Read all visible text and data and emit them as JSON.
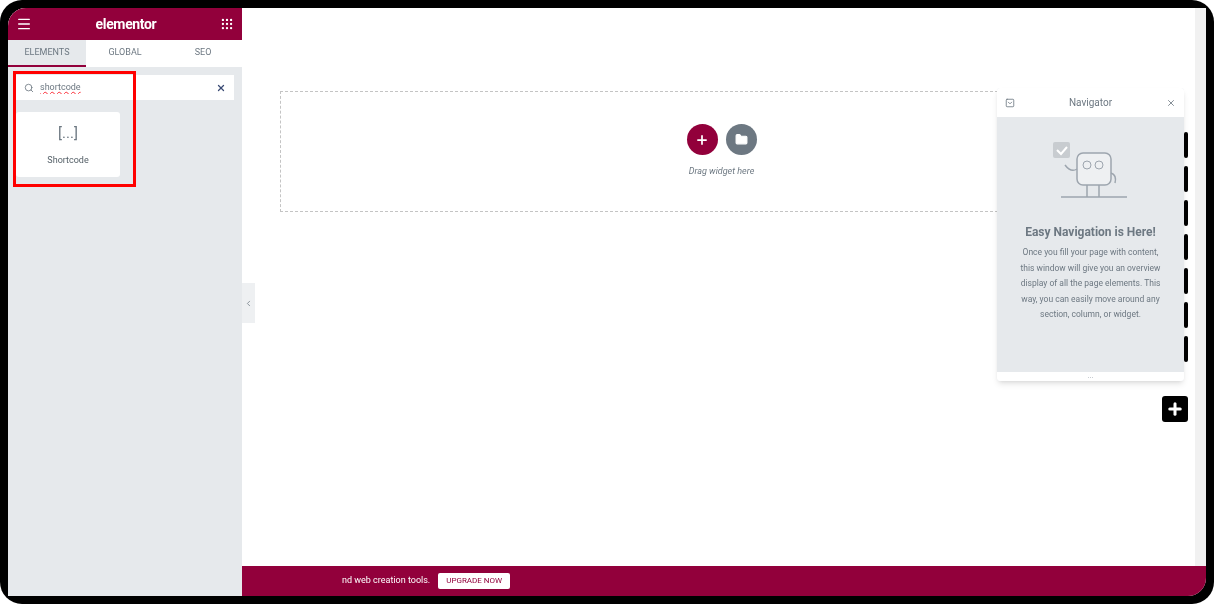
{
  "panel": {
    "logo": "elementor",
    "tabs": [
      {
        "label": "ELEMENTS",
        "selected": true
      },
      {
        "label": "GLOBAL",
        "selected": false
      },
      {
        "label": "SEO",
        "selected": false
      }
    ],
    "search": {
      "value": "shortcode"
    },
    "widgets": [
      {
        "glyph": "[...]",
        "label": "Shortcode"
      }
    ],
    "highlighted": true
  },
  "canvas": {
    "hint": "Drag widget here"
  },
  "navigator": {
    "title": "Navigator",
    "heading": "Easy Navigation is Here!",
    "body": "Once you fill your page with content, this window will give you an overview display of all the page elements. This way, you can easily move around any section, column, or widget.",
    "footer": "..."
  },
  "promo_bar": {
    "text": "nd web creation tools.",
    "button": "UPGRADE NOW"
  }
}
